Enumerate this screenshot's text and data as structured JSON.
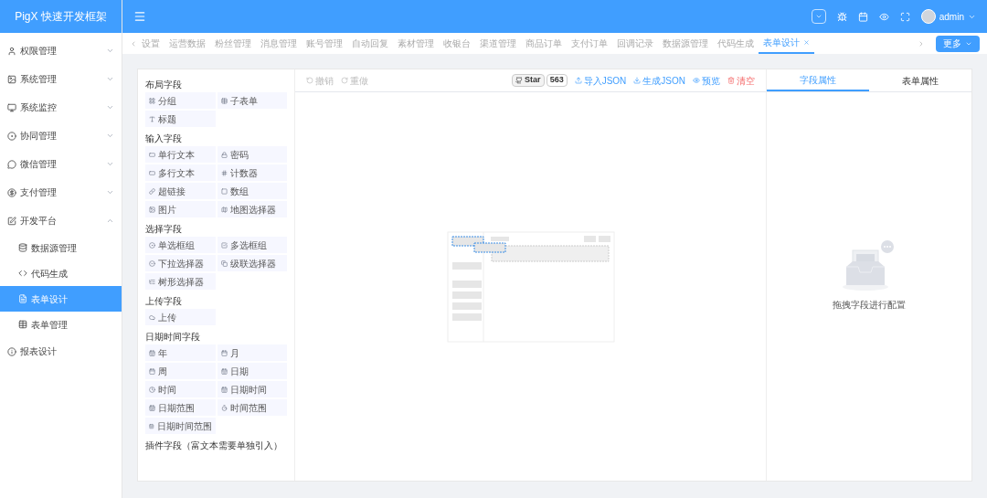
{
  "header": {
    "title": "PigX 快速开发框架",
    "user": "admin"
  },
  "sidebar": {
    "items": [
      {
        "label": "权限管理",
        "expanded": false
      },
      {
        "label": "系统管理",
        "expanded": false
      },
      {
        "label": "系统监控",
        "expanded": false
      },
      {
        "label": "协同管理",
        "expanded": false
      },
      {
        "label": "微信管理",
        "expanded": false
      },
      {
        "label": "支付管理",
        "expanded": false
      },
      {
        "label": "开发平台",
        "expanded": true,
        "children": [
          {
            "label": "数据源管理",
            "selected": false
          },
          {
            "label": "代码生成",
            "selected": false
          },
          {
            "label": "表单设计",
            "selected": true
          },
          {
            "label": "表单管理",
            "selected": false
          }
        ]
      },
      {
        "label": "报表设计"
      }
    ]
  },
  "tabs": [
    {
      "label": "设置",
      "selected": false
    },
    {
      "label": "运营数据",
      "selected": false
    },
    {
      "label": "粉丝管理",
      "selected": false
    },
    {
      "label": "消息管理",
      "selected": false
    },
    {
      "label": "账号管理",
      "selected": false
    },
    {
      "label": "自动回复",
      "selected": false
    },
    {
      "label": "素材管理",
      "selected": false
    },
    {
      "label": "收银台",
      "selected": false
    },
    {
      "label": "渠道管理",
      "selected": false
    },
    {
      "label": "商品订单",
      "selected": false
    },
    {
      "label": "支付订单",
      "selected": false
    },
    {
      "label": "回调记录",
      "selected": false
    },
    {
      "label": "数据源管理",
      "selected": false
    },
    {
      "label": "代码生成",
      "selected": false
    },
    {
      "label": "表单设计",
      "selected": true
    }
  ],
  "more_button": "更多",
  "field_groups": [
    {
      "title": "布局字段",
      "items": [
        "分组",
        "子表单",
        "标题"
      ]
    },
    {
      "title": "输入字段",
      "items": [
        "单行文本",
        "密码",
        "多行文本",
        "计数器",
        "超链接",
        "数组",
        "图片",
        "地图选择器"
      ]
    },
    {
      "title": "选择字段",
      "items": [
        "单选框组",
        "多选框组",
        "下拉选择器",
        "级联选择器",
        "树形选择器"
      ]
    },
    {
      "title": "上传字段",
      "items": [
        "上传"
      ]
    },
    {
      "title": "日期时间字段",
      "items": [
        "年",
        "月",
        "周",
        "日期",
        "时间",
        "日期时间",
        "日期范围",
        "时间范围",
        "日期时间范围"
      ]
    },
    {
      "title": "插件字段（富文本需要单独引入）"
    }
  ],
  "toolbar": {
    "undo": {
      "label": "撤销",
      "disabled": true
    },
    "redo": {
      "label": "重做",
      "disabled": true
    },
    "star": "Star",
    "star_count": "563",
    "actions": [
      {
        "label": "导入JSON",
        "kind": "upload"
      },
      {
        "label": "生成JSON",
        "kind": "download"
      },
      {
        "label": "预览",
        "kind": "preview"
      },
      {
        "label": "清空",
        "kind": "clear"
      }
    ]
  },
  "props_tabs": [
    {
      "label": "字段属性",
      "selected": true
    },
    {
      "label": "表单属性",
      "selected": false
    }
  ],
  "empty_text": "拖拽字段进行配置"
}
